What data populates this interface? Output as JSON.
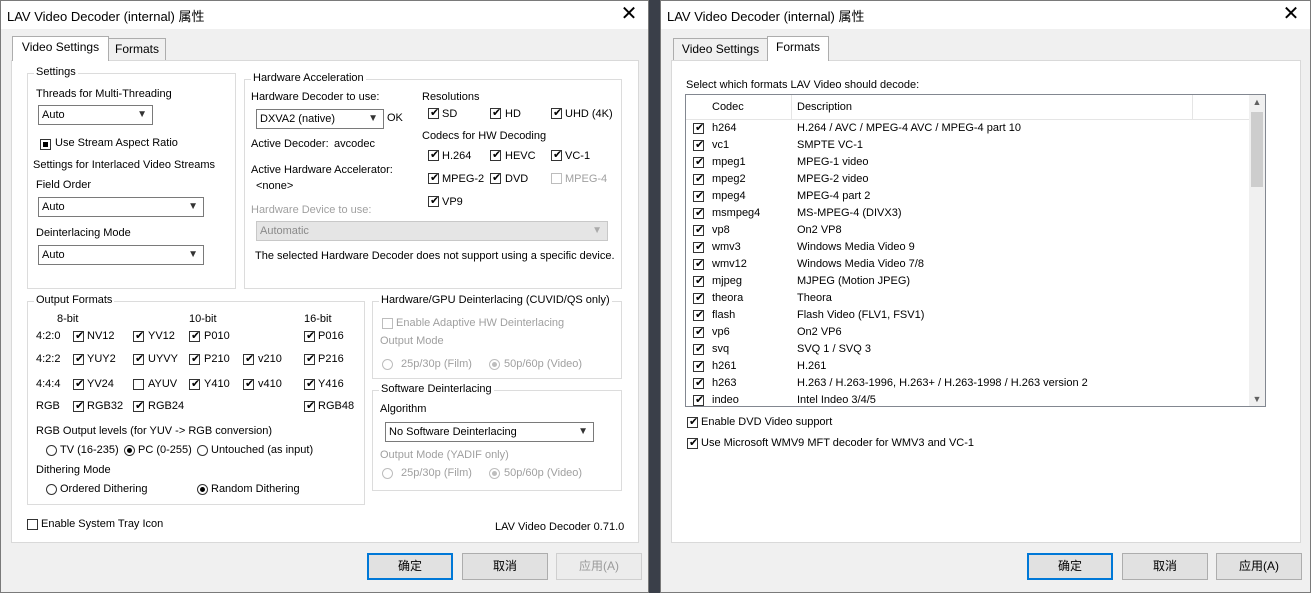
{
  "left": {
    "title": "LAV Video Decoder (internal) 属性",
    "tabs": [
      "Video Settings",
      "Formats"
    ],
    "settings": {
      "title": "Settings",
      "threads_label": "Threads for Multi-Threading",
      "threads_value": "Auto",
      "stream_aspect": "Use Stream Aspect Ratio",
      "interlaced_title": "Settings for Interlaced Video Streams",
      "field_order_label": "Field Order",
      "field_order_value": "Auto",
      "deint_mode_label": "Deinterlacing Mode",
      "deint_mode_value": "Auto"
    },
    "hwaccel": {
      "title": "Hardware Acceleration",
      "decoder_label": "Hardware Decoder to use:",
      "decoder_value": "DXVA2 (native)",
      "decoder_status": "OK",
      "active_decoder_label": "Active Decoder:",
      "active_decoder_value": "avcodec",
      "active_accel_label": "Active Hardware Accelerator:",
      "active_accel_value": "<none>",
      "device_label": "Hardware Device to use:",
      "device_value": "Automatic",
      "device_note": "The selected Hardware Decoder does not support using a specific device.",
      "resolutions_title": "Resolutions",
      "res": [
        "SD",
        "HD",
        "UHD (4K)"
      ],
      "codecs_title": "Codecs for HW Decoding",
      "codecs": [
        "H.264",
        "HEVC",
        "VC-1",
        "MPEG-2",
        "DVD",
        "MPEG-4",
        "VP9"
      ]
    },
    "output": {
      "title": "Output Formats",
      "cols": [
        "8-bit",
        "10-bit",
        "16-bit"
      ],
      "rows": [
        "4:2:0",
        "4:2:2",
        "4:4:4",
        "RGB"
      ],
      "fmt": [
        "NV12",
        "YV12",
        "P010",
        "P016",
        "YUY2",
        "UYVY",
        "P210",
        "v210",
        "P216",
        "YV24",
        "AYUV",
        "Y410",
        "v410",
        "Y416",
        "RGB32",
        "RGB24",
        "RGB48"
      ],
      "levels_label": "RGB Output levels (for YUV -> RGB conversion)",
      "levels": [
        "TV (16-235)",
        "PC (0-255)",
        "Untouched (as input)"
      ],
      "dither_label": "Dithering Mode",
      "dither": [
        "Ordered Dithering",
        "Random Dithering"
      ]
    },
    "gpu_deint": {
      "title": "Hardware/GPU Deinterlacing (CUVID/QS only)",
      "adaptive": "Enable Adaptive HW Deinterlacing",
      "output_mode": "Output Mode",
      "opt_film": "25p/30p (Film)",
      "opt_video": "50p/60p (Video)"
    },
    "sw_deint": {
      "title": "Software Deinterlacing",
      "algorithm_label": "Algorithm",
      "algorithm_value": "No Software Deinterlacing",
      "output_mode": "Output Mode (YADIF only)",
      "opt_film": "25p/30p (Film)",
      "opt_video": "50p/60p (Video)"
    },
    "tray": "Enable System Tray Icon",
    "version": "LAV Video Decoder 0.71.0",
    "buttons": [
      "确定",
      "取消",
      "应用(A)"
    ]
  },
  "right": {
    "title": "LAV Video Decoder (internal) 属性",
    "tabs": [
      "Video Settings",
      "Formats"
    ],
    "prompt": "Select which formats LAV Video should decode:",
    "col_codec": "Codec",
    "col_desc": "Description",
    "rows": [
      {
        "codec": "h264",
        "desc": "H.264 / AVC / MPEG-4 AVC / MPEG-4 part 10"
      },
      {
        "codec": "vc1",
        "desc": "SMPTE VC-1"
      },
      {
        "codec": "mpeg1",
        "desc": "MPEG-1 video"
      },
      {
        "codec": "mpeg2",
        "desc": "MPEG-2 video"
      },
      {
        "codec": "mpeg4",
        "desc": "MPEG-4 part 2"
      },
      {
        "codec": "msmpeg4",
        "desc": "MS-MPEG-4 (DIVX3)"
      },
      {
        "codec": "vp8",
        "desc": "On2 VP8"
      },
      {
        "codec": "wmv3",
        "desc": "Windows Media Video 9"
      },
      {
        "codec": "wmv12",
        "desc": "Windows Media Video 7/8"
      },
      {
        "codec": "mjpeg",
        "desc": "MJPEG (Motion JPEG)"
      },
      {
        "codec": "theora",
        "desc": "Theora"
      },
      {
        "codec": "flash",
        "desc": "Flash Video (FLV1, FSV1)"
      },
      {
        "codec": "vp6",
        "desc": "On2 VP6"
      },
      {
        "codec": "svq",
        "desc": "SVQ 1 / SVQ 3"
      },
      {
        "codec": "h261",
        "desc": "H.261"
      },
      {
        "codec": "h263",
        "desc": "H.263 / H.263-1996, H.263+ / H.263-1998 / H.263 version 2"
      },
      {
        "codec": "indeo",
        "desc": "Intel Indeo 3/4/5"
      }
    ],
    "dvd_support": "Enable DVD Video support",
    "wmv9_mft": "Use Microsoft WMV9 MFT decoder for WMV3 and VC-1",
    "buttons": [
      "确定",
      "取消",
      "应用(A)"
    ]
  },
  "icons": {
    "close": "close-icon",
    "dropdown": "chevron-down-icon",
    "check": "checkmark-icon"
  }
}
